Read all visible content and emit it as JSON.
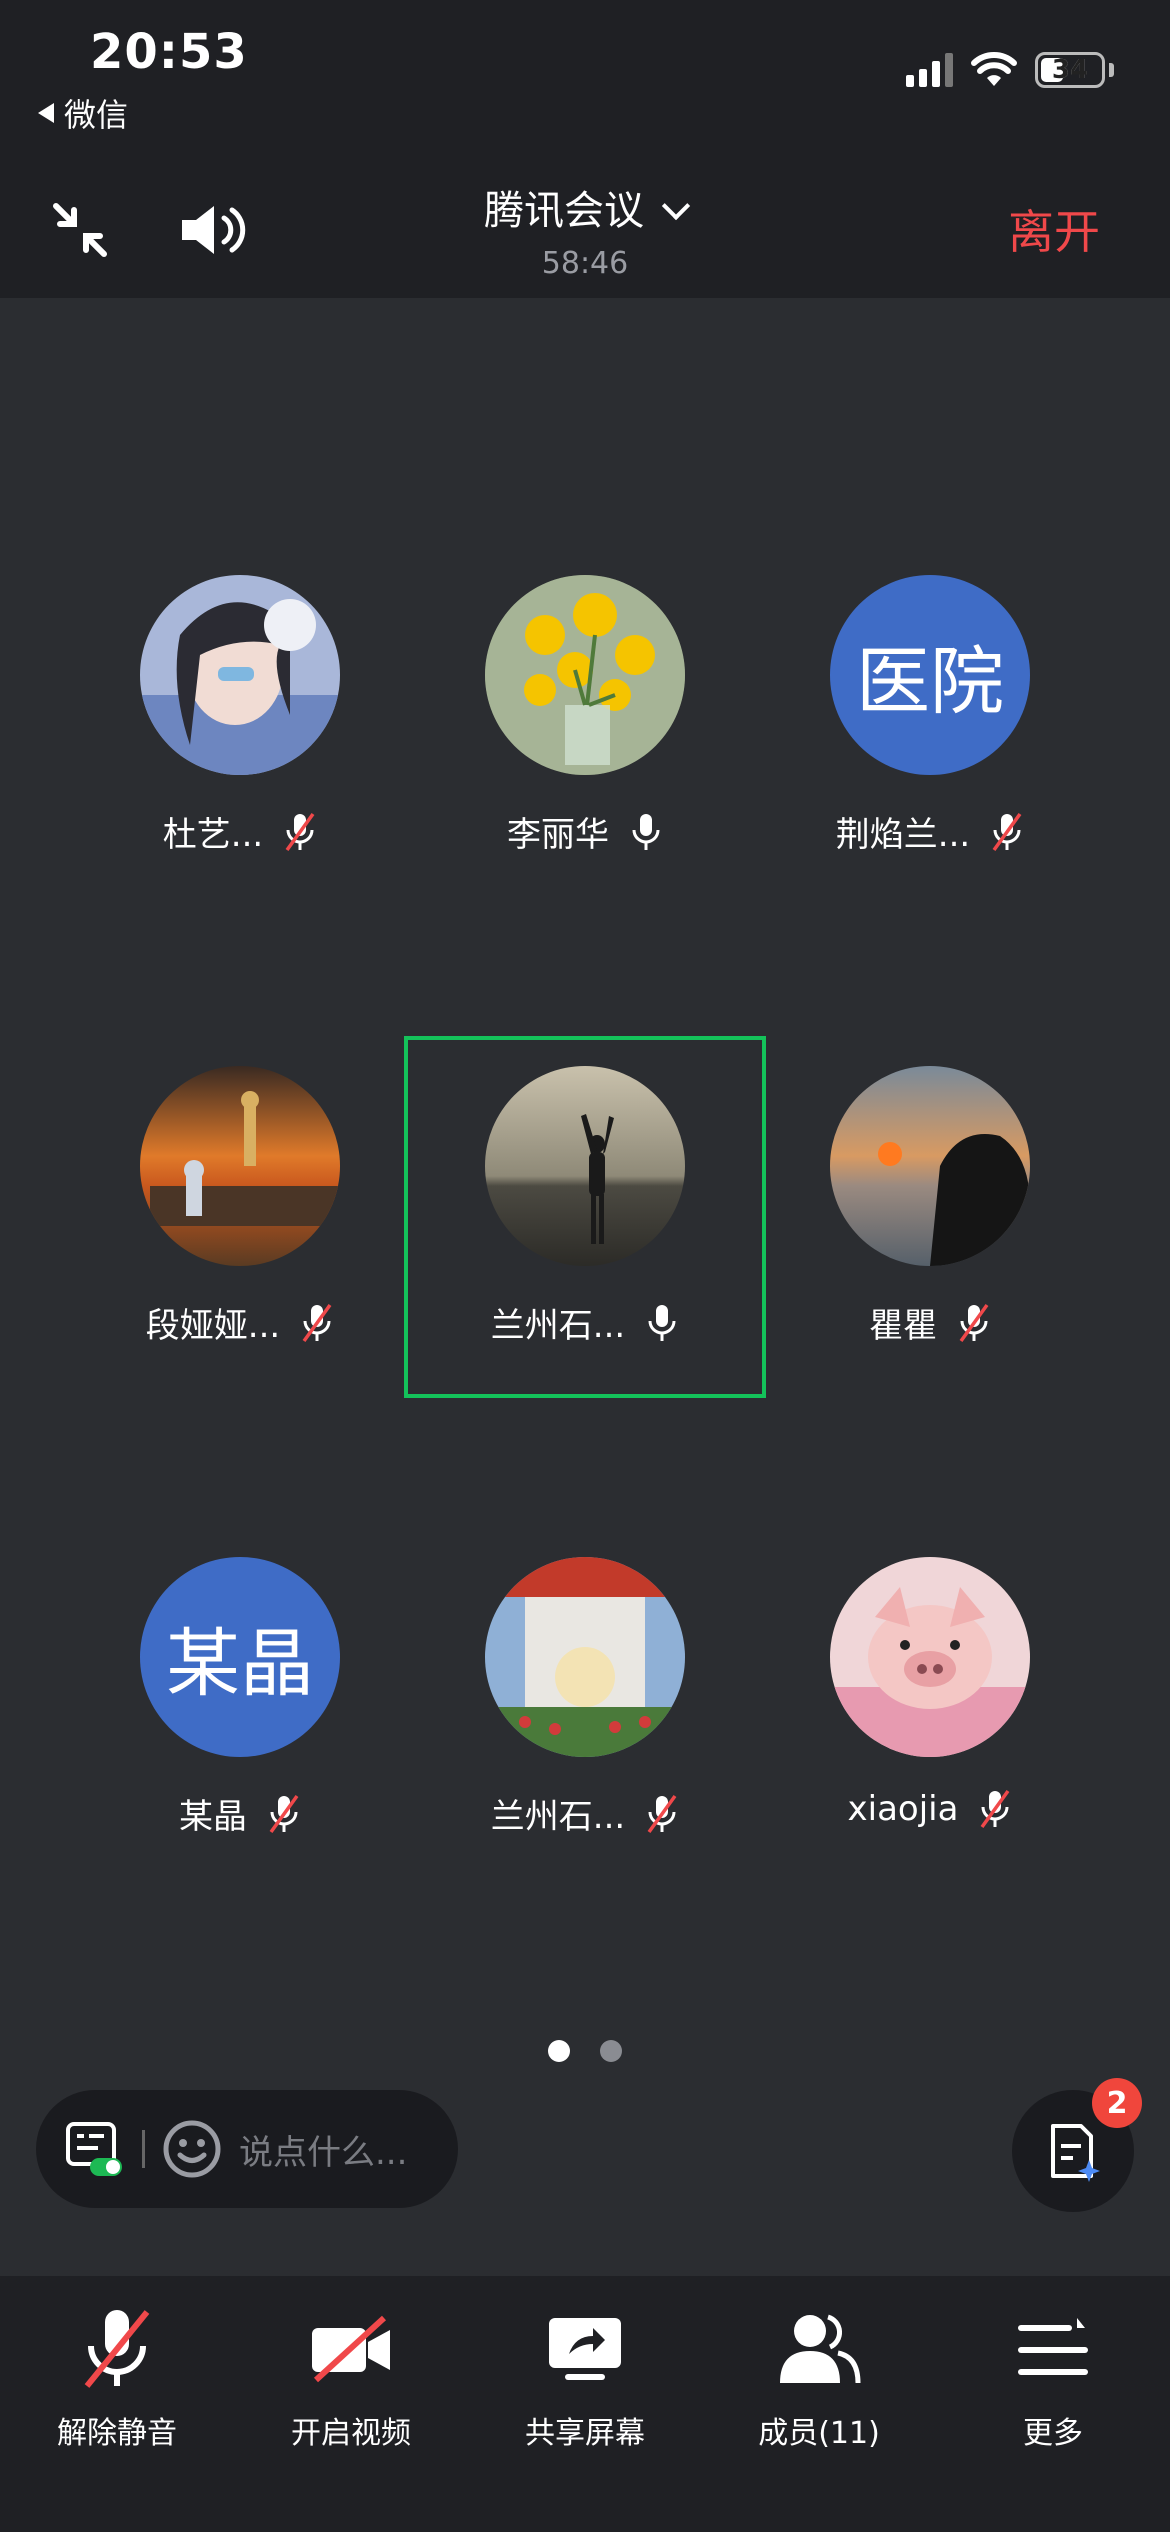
{
  "status_bar": {
    "time": "20:53",
    "back_app": "微信",
    "battery": "34"
  },
  "header": {
    "title": "腾讯会议",
    "timer": "58:46",
    "leave_label": "离开"
  },
  "participants": [
    {
      "name": "杜艺...",
      "avatar_type": "image",
      "mic": "muted"
    },
    {
      "name": "李丽华",
      "avatar_type": "image",
      "mic": "on"
    },
    {
      "name": "荆焰兰...",
      "avatar_type": "text",
      "avatar_text": "医院",
      "mic": "muted"
    },
    {
      "name": "段娅娅...",
      "avatar_type": "image",
      "mic": "muted"
    },
    {
      "name": "兰州石...",
      "avatar_type": "image",
      "mic": "on",
      "speaking": true
    },
    {
      "name": "瞿瞿",
      "avatar_type": "image",
      "mic": "muted"
    },
    {
      "name": "某晶",
      "avatar_type": "text",
      "avatar_text": "某晶",
      "mic": "muted"
    },
    {
      "name": "兰州石...",
      "avatar_type": "image",
      "mic": "muted"
    },
    {
      "name": "xiaojia",
      "avatar_type": "image",
      "mic": "muted"
    }
  ],
  "pager": {
    "current": 1,
    "total": 2
  },
  "chat": {
    "placeholder": "说点什么...",
    "notes_badge": "2"
  },
  "toolbar": {
    "unmute": "解除静音",
    "video": "开启视频",
    "share": "共享屏幕",
    "members": "成员(11)",
    "more": "更多"
  },
  "colors": {
    "accent_leave": "#f0484a",
    "speaking_border": "#14c25a",
    "text_avatar_bg": "#3f6cc6",
    "badge": "#f0463c"
  }
}
